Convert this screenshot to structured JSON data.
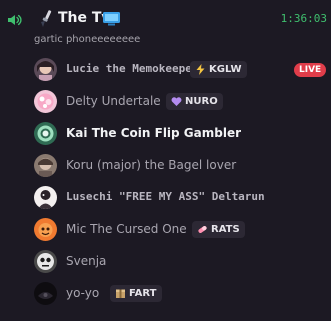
{
  "channel": {
    "name": "The Tv",
    "status": "gartic phoneeeeeeee",
    "timer": "1:36:03",
    "speaker_icon": "speaker-icon",
    "emoji_icon": "brush-icon",
    "tv_icon": "tv-icon"
  },
  "members": [
    {
      "name": "Lucie the Memokeeper",
      "tag": "KGLW",
      "tag_icon": "lightning-icon",
      "live": "LIVE"
    },
    {
      "name": "Delty Undertale",
      "tag": "NURO",
      "tag_icon": "purple-heart-icon"
    },
    {
      "name": "Kai The Coin Flip Gambler"
    },
    {
      "name": "Koru (major) the Bagel lover"
    },
    {
      "name": "Lusechi \"FREE MY ASS\" Deltarun"
    },
    {
      "name": "Mic The Cursed One",
      "tag": "RATS",
      "tag_icon": "pill-icon"
    },
    {
      "name": "Svenja"
    },
    {
      "name": "yo-yo",
      "tag": "FART",
      "tag_icon": "box-icon"
    }
  ],
  "colors": {
    "background": "#1c1923",
    "timer": "#3fbf6e",
    "live": "#e03d4a",
    "speaker": "#3fbf6e"
  }
}
